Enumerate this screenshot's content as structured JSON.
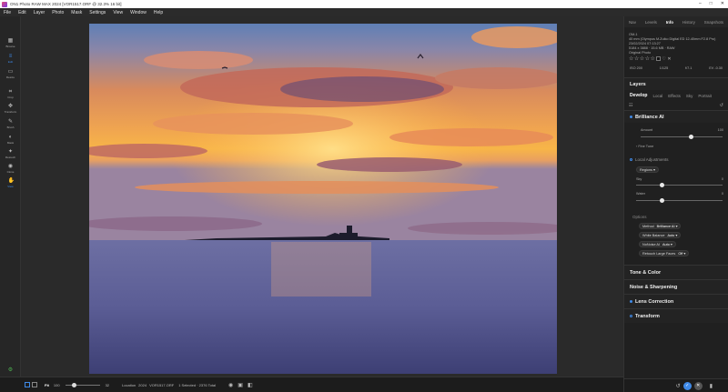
{
  "window": {
    "title": "ON1 Photo RAW MAX 2024  [VOR1517.ORF @ 32.3% 16 bit]",
    "controls": [
      "–",
      "□",
      "✕"
    ]
  },
  "menu": [
    "File",
    "Edit",
    "Layer",
    "Photo",
    "Mask",
    "Settings",
    "View",
    "Window",
    "Help"
  ],
  "tools": [
    {
      "label": "Browse",
      "icon": "grid-icon",
      "active": false
    },
    {
      "label": "Edit",
      "icon": "sliders-icon",
      "active": true
    },
    {
      "label": "Resize",
      "icon": "resize-icon",
      "active": false
    },
    {
      "label": "Crop",
      "icon": "crop-icon",
      "active": false
    },
    {
      "label": "Transform",
      "icon": "move-icon",
      "active": false
    },
    {
      "label": "Brush",
      "icon": "brush-icon",
      "active": false
    },
    {
      "label": "Mask",
      "icon": "mask-icon",
      "active": false
    },
    {
      "label": "Retouch",
      "icon": "retouch-icon",
      "active": false
    },
    {
      "label": "Clone",
      "icon": "clone-icon",
      "active": false
    },
    {
      "label": "View",
      "icon": "hand-icon",
      "active": true
    }
  ],
  "bottombar": {
    "fit_label": "Fit",
    "zoom_value": "100",
    "zoom_max": "32",
    "zoom_level": 0.25,
    "location": "Location",
    "year": "2024",
    "filename": "VOR1517.ORF",
    "selected": "1 Selected · 2376 Total"
  },
  "right": {
    "tabs": [
      "Nav",
      "Levels",
      "Info",
      "History",
      "Snapshots"
    ],
    "active_tab": "Info",
    "info": {
      "camera": "OM-1",
      "lens": "40 mm (Olympus M.Zuiko Digital ED 12-40mm F2.8 Pro)",
      "date": "23/02/2024 07:13:27",
      "size": "5184 x 3888 · 15.6 MB · RAW",
      "type": "Original Photo",
      "iso": "ISO 200",
      "shutter": "1/125",
      "aperture": "f/7.1",
      "ev": "EV -0.30"
    },
    "layers_label": "Layers",
    "subtabs": [
      "Develop",
      "Local",
      "Effects",
      "Sky",
      "Portrait"
    ],
    "active_subtab": "Develop",
    "brilliance": {
      "title": "Brilliance AI",
      "amount_label": "Amount",
      "amount_value": "100",
      "amount_level": 1.0,
      "finetune_label": "Fine Tune"
    },
    "local_adj": {
      "title": "Local Adjustments",
      "regions_label": "Regions",
      "sky_label": "Sky",
      "sky_value": "0",
      "sky_level": 0.5,
      "water_label": "Water",
      "water_value": "0",
      "water_level": 0.5
    },
    "options": {
      "title": "Options",
      "rows": [
        {
          "label": "Method",
          "value": "Brilliance AI"
        },
        {
          "label": "White Balance",
          "value": "Auto"
        },
        {
          "label": "NoNoise AI",
          "value": "Auto"
        },
        {
          "label": "Retouch Large Faces",
          "value": "Off"
        }
      ]
    },
    "sections": [
      "Tone & Color",
      "Noise & Sharpening",
      "Lens Correction",
      "Transform"
    ]
  }
}
